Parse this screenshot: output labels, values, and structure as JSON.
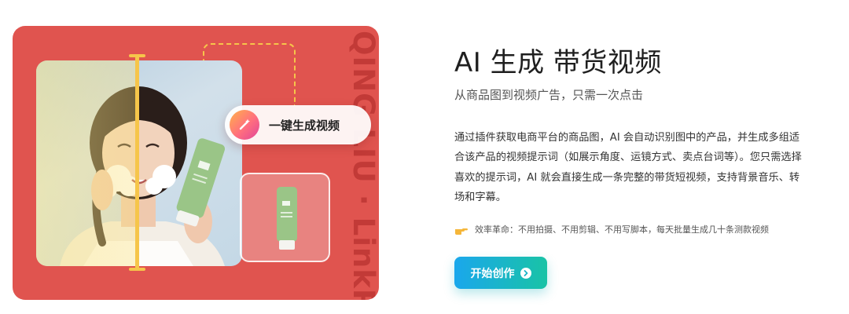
{
  "hero_visual": {
    "vertical_brand": "QING LIU · LinkPix",
    "generate_pill_label": "一键生成视频",
    "icons": [
      "magic-wand-icon"
    ],
    "colors": {
      "card": "#e0544f",
      "accent_yellow": "#f6c54a",
      "brand_text": "#c23a37"
    }
  },
  "content": {
    "title": "AI 生成 带货视频",
    "subtitle": "从商品图到视频广告，只需一次点击",
    "description_lines": [
      "通过插件获取电商平台的商品图，AI 会自动识别图中的产品，并生成多组适",
      "合该产品的视频提示词（如展示角度、运镜方式、卖点台词等）。您只需选择",
      "喜欢的提示词，AI 就会直接生成一条完整的带货短视频，支持背景音乐、转",
      "场和字幕。"
    ],
    "note": "效率革命：不用拍摄、不用剪辑、不用写脚本，每天批量生成几十条测款视频",
    "note_icon": "pointing-hand-icon",
    "cta_label": "开始创作",
    "cta_icon": "arrow-right-circle-icon",
    "cta_gradient": [
      "#1aa7ec",
      "#19c3a6"
    ]
  }
}
